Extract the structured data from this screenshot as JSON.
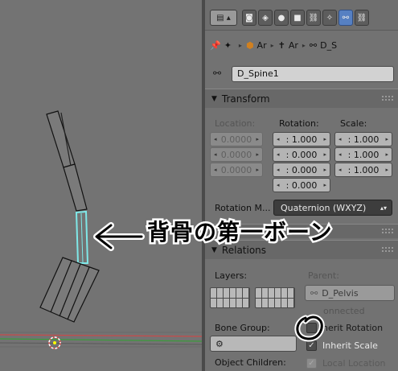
{
  "header": {
    "mode_icon": "view-layers-icon",
    "tab_icons": [
      "render-icon",
      "scene-icon",
      "world-icon",
      "object-icon",
      "constraint-icon",
      "modifier-icon",
      "bone-icon",
      "bone-constraint-icon"
    ],
    "active_tab": "bone-icon"
  },
  "breadcrumb": {
    "pin_icon": "pin-icon",
    "items": [
      {
        "icon": "scene-icon",
        "label": ""
      },
      {
        "icon": "armature-object-icon",
        "label": "Ar"
      },
      {
        "icon": "armature-data-icon",
        "label": "Ar"
      },
      {
        "icon": "bone-icon",
        "label": "D_S"
      }
    ]
  },
  "bone_name": "D_Spine1",
  "transform": {
    "title": "Transform",
    "location_label": "Location:",
    "rotation_label": "Rotation:",
    "scale_label": "Scale:",
    "location": [
      "0.0000",
      "0.0000",
      "0.0000"
    ],
    "rotation": [
      ": 1.000",
      ": 0.000",
      ": 0.000",
      ": 0.000"
    ],
    "scale": [
      ": 1.000",
      ": 1.000",
      ": 1.000"
    ],
    "rotation_mode_label": "Rotation M...",
    "rotation_mode_value": "Quaternion (WXYZ)"
  },
  "relations": {
    "title": "Relations",
    "layers_label": "Layers:",
    "parent_label": "Parent:",
    "parent_value": "D_Pelvis",
    "connected_label": "onnected",
    "bone_group_label": "Bone Group:",
    "inherit_rotation_label": "herit Rotation",
    "inherit_scale_label": "Inherit Scale",
    "object_children_label": "Object Children:",
    "local_location_label": "Local Location"
  },
  "annotation": {
    "text": "背骨の第一ボーン"
  },
  "colors": {
    "viewport_bg": "#737373",
    "selected_bone": "#9ff0f0",
    "active_tab": "#5680c2",
    "dropdown_bg": "#3d3d3d"
  }
}
